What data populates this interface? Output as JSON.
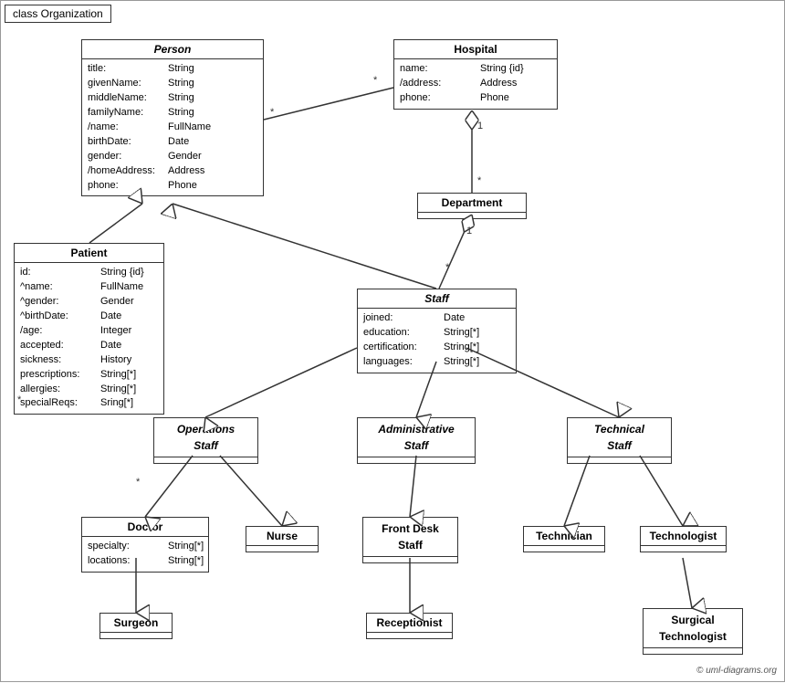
{
  "title": "class Organization",
  "classes": {
    "person": {
      "name": "Person",
      "italic": true,
      "attrs": [
        {
          "name": "title:",
          "type": "String"
        },
        {
          "name": "givenName:",
          "type": "String"
        },
        {
          "name": "middleName:",
          "type": "String"
        },
        {
          "name": "familyName:",
          "type": "String"
        },
        {
          "name": "/name:",
          "type": "FullName"
        },
        {
          "name": "birthDate:",
          "type": "Date"
        },
        {
          "name": "gender:",
          "type": "Gender"
        },
        {
          "name": "/homeAddress:",
          "type": "Address"
        },
        {
          "name": "phone:",
          "type": "Phone"
        }
      ]
    },
    "hospital": {
      "name": "Hospital",
      "italic": false,
      "attrs": [
        {
          "name": "name:",
          "type": "String {id}"
        },
        {
          "name": "/address:",
          "type": "Address"
        },
        {
          "name": "phone:",
          "type": "Phone"
        }
      ]
    },
    "department": {
      "name": "Department",
      "italic": false,
      "attrs": []
    },
    "staff": {
      "name": "Staff",
      "italic": true,
      "attrs": [
        {
          "name": "joined:",
          "type": "Date"
        },
        {
          "name": "education:",
          "type": "String[*]"
        },
        {
          "name": "certification:",
          "type": "String[*]"
        },
        {
          "name": "languages:",
          "type": "String[*]"
        }
      ]
    },
    "patient": {
      "name": "Patient",
      "italic": false,
      "attrs": [
        {
          "name": "id:",
          "type": "String {id}"
        },
        {
          "name": "^name:",
          "type": "FullName"
        },
        {
          "name": "^gender:",
          "type": "Gender"
        },
        {
          "name": "^birthDate:",
          "type": "Date"
        },
        {
          "name": "/age:",
          "type": "Integer"
        },
        {
          "name": "accepted:",
          "type": "Date"
        },
        {
          "name": "sickness:",
          "type": "History"
        },
        {
          "name": "prescriptions:",
          "type": "String[*]"
        },
        {
          "name": "allergies:",
          "type": "String[*]"
        },
        {
          "name": "specialReqs:",
          "type": "Sring[*]"
        }
      ]
    },
    "operations_staff": {
      "name": "Operations\nStaff",
      "italic": true,
      "attrs": []
    },
    "administrative_staff": {
      "name": "Administrative\nStaff",
      "italic": true,
      "attrs": []
    },
    "technical_staff": {
      "name": "Technical\nStaff",
      "italic": true,
      "attrs": []
    },
    "doctor": {
      "name": "Doctor",
      "italic": false,
      "attrs": [
        {
          "name": "specialty:",
          "type": "String[*]"
        },
        {
          "name": "locations:",
          "type": "String[*]"
        }
      ]
    },
    "nurse": {
      "name": "Nurse",
      "italic": false,
      "attrs": []
    },
    "front_desk_staff": {
      "name": "Front Desk\nStaff",
      "italic": false,
      "attrs": []
    },
    "technician": {
      "name": "Technician",
      "italic": false,
      "attrs": []
    },
    "technologist": {
      "name": "Technologist",
      "italic": false,
      "attrs": []
    },
    "surgeon": {
      "name": "Surgeon",
      "italic": false,
      "attrs": []
    },
    "receptionist": {
      "name": "Receptionist",
      "italic": false,
      "attrs": []
    },
    "surgical_technologist": {
      "name": "Surgical\nTechnologist",
      "italic": false,
      "attrs": []
    }
  },
  "multiplicity": {
    "star": "*",
    "one": "1"
  },
  "copyright": "© uml-diagrams.org"
}
